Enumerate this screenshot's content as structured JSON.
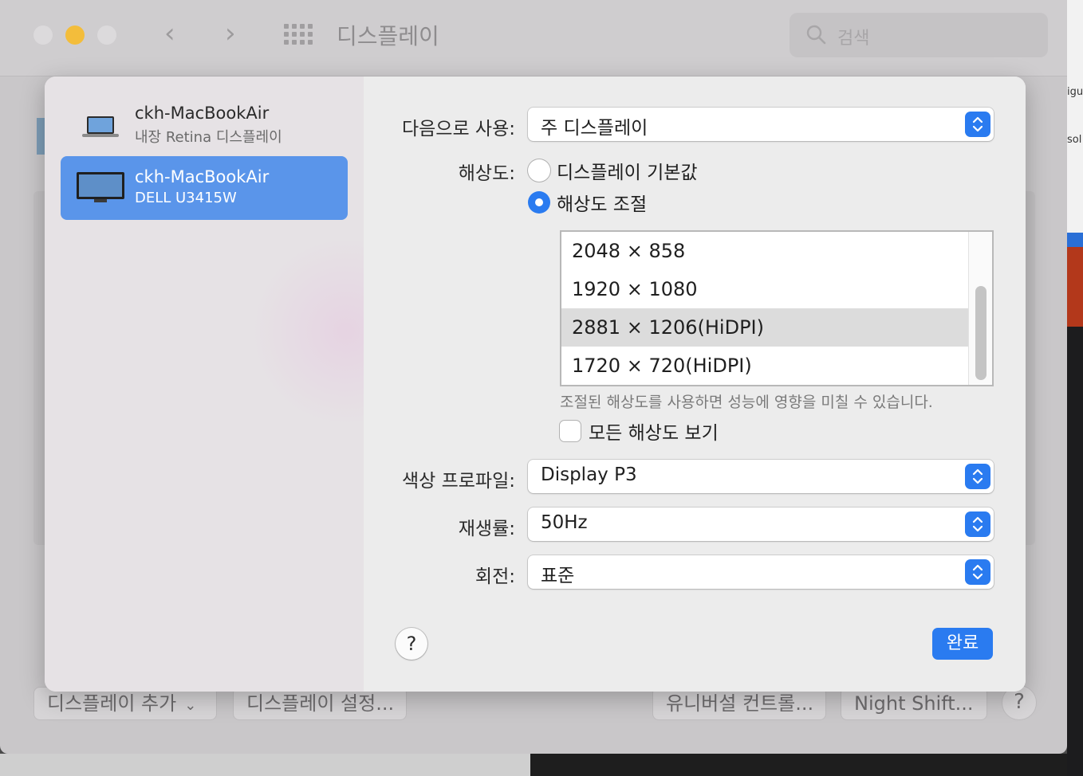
{
  "window": {
    "title": "디스플레이",
    "search_placeholder": "검색"
  },
  "bottom_buttons": {
    "add_display": "디스플레이 추가",
    "display_settings": "디스플레이 설정...",
    "universal_control": "유니버설 컨트롤...",
    "night_shift": "Night Shift...",
    "help": "?"
  },
  "sidebar": {
    "devices": [
      {
        "name": "ckh-MacBookAir",
        "subtitle": "내장 Retina 디스플레이",
        "icon": "laptop-icon",
        "selected": false
      },
      {
        "name": "ckh-MacBookAir",
        "subtitle": "DELL U3415W",
        "icon": "monitor-icon",
        "selected": true
      }
    ]
  },
  "settings": {
    "use_as": {
      "label": "다음으로 사용:",
      "value": "주 디스플레이"
    },
    "resolution": {
      "label": "해상도:",
      "options": [
        {
          "label": "디스플레이 기본값",
          "selected": false
        },
        {
          "label": "해상도 조절",
          "selected": true
        }
      ],
      "list": [
        {
          "value": "2048 × 858",
          "selected": false
        },
        {
          "value": "1920 × 1080",
          "selected": false
        },
        {
          "value": "2881 × 1206(HiDPI)",
          "selected": true
        },
        {
          "value": "1720 × 720(HiDPI)",
          "selected": false
        }
      ],
      "note": "조절된 해상도를 사용하면 성능에 영향을 미칠 수 있습니다.",
      "show_all_label": "모든 해상도 보기",
      "show_all_checked": false
    },
    "color_profile": {
      "label": "색상 프로파일:",
      "value": "Display P3"
    },
    "refresh_rate": {
      "label": "재생률:",
      "value": "50Hz"
    },
    "rotation": {
      "label": "회전:",
      "value": "표준"
    }
  },
  "sheet_buttons": {
    "help": "?",
    "done": "완료"
  },
  "colors": {
    "accent": "#2a7bf0",
    "sidebar_selected": "#5a95ea",
    "minimize": "#f3bd3b"
  }
}
